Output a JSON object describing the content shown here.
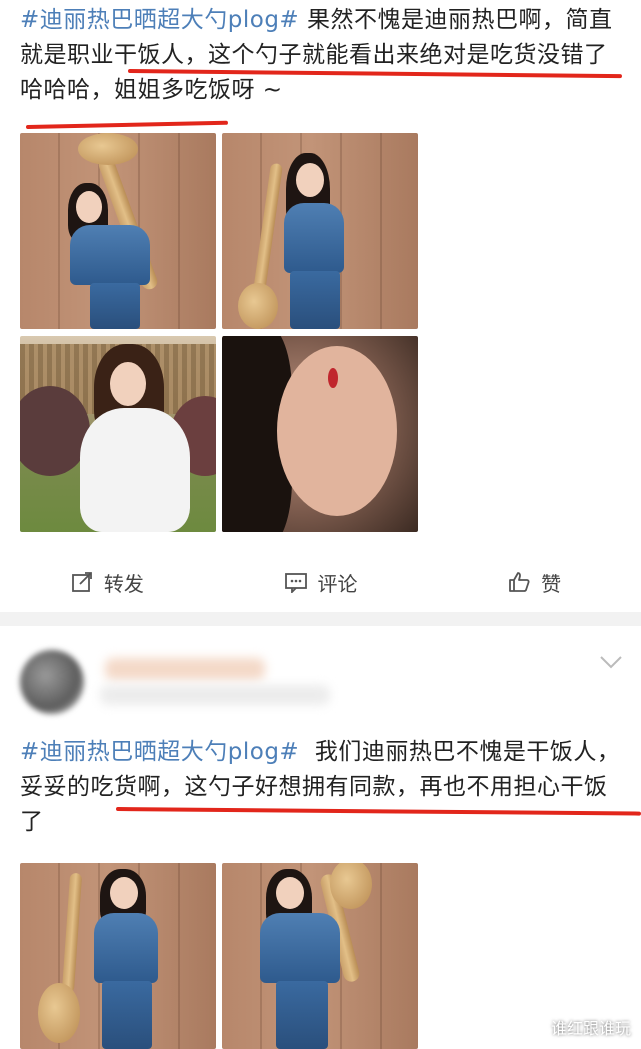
{
  "post1": {
    "hashtag": "#迪丽热巴晒超大勺plog#",
    "body": "果然不愧是迪丽热巴啊，简直就是职业干饭人，这个勺子就能看出来绝对是吃货没错了哈哈哈，姐姐多吃饭呀 ~"
  },
  "actions": {
    "repost_label": "转发",
    "comment_label": "评论",
    "like_label": "赞"
  },
  "post2": {
    "hashtag": "#迪丽热巴晒超大勺plog#",
    "body": "我们迪丽热巴不愧是干饭人，妥妥的吃货啊，这勺子好想拥有同款，再也不用担心干饭了"
  },
  "watermark": "谁红跟谁玩",
  "colors": {
    "hashtag": "#4d7fb8",
    "underline": "#e2261b",
    "text": "#222222",
    "separator": "#f2f2f2"
  },
  "icons": [
    "repost-icon",
    "comment-icon",
    "like-icon",
    "chevron-down-icon"
  ]
}
